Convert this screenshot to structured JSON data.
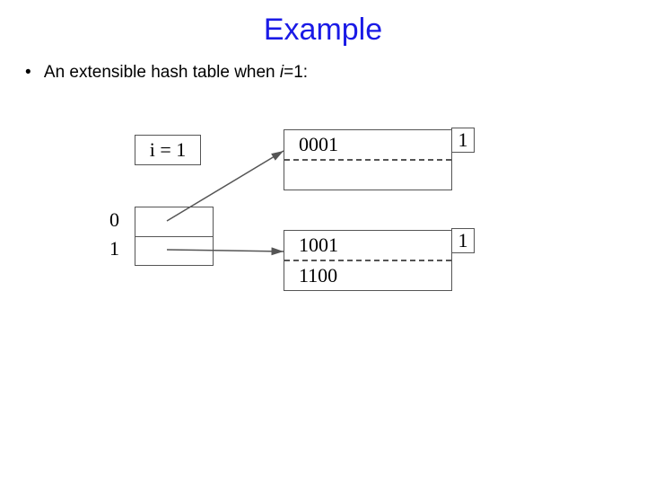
{
  "title": "Example",
  "bullet": {
    "text_before_i": "An extensible hash table when ",
    "var_i": "i",
    "text_after_i": "=1:"
  },
  "diagram": {
    "i_box": "i = 1",
    "directory": {
      "label0": "0",
      "label1": "1"
    },
    "bucketA": {
      "row0": "0001",
      "nub": "1"
    },
    "bucketB": {
      "row0": "1001",
      "row1": "1100",
      "nub": "1"
    }
  }
}
